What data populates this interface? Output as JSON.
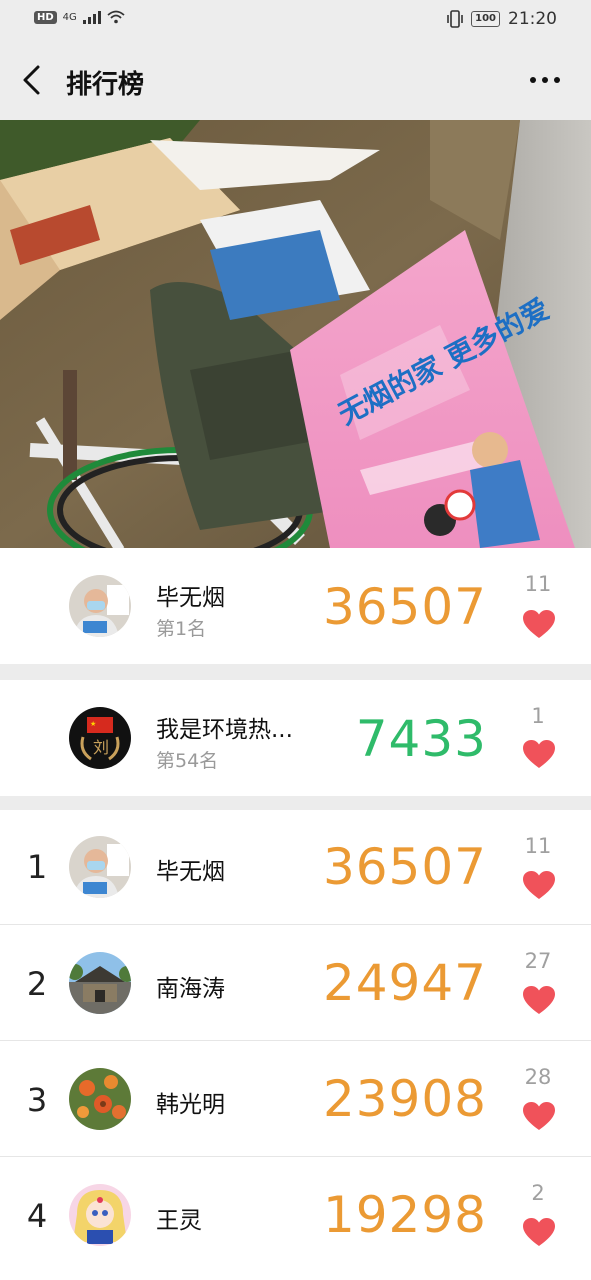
{
  "status_bar": {
    "hd": "HD",
    "network": "4G",
    "battery": "100",
    "time": "21:20"
  },
  "header": {
    "title": "排行榜"
  },
  "my_entries": [
    {
      "name": "毕无烟",
      "rank_label": "第1名",
      "steps": "36507",
      "likes": "11",
      "steps_color": "#eb9a34"
    },
    {
      "name": "我是环境热...",
      "rank_label": "第54名",
      "steps": "7433",
      "likes": "1",
      "steps_color": "#2fbb6a"
    }
  ],
  "ranking": [
    {
      "position": "1",
      "name": "毕无烟",
      "steps": "36507",
      "likes": "11"
    },
    {
      "position": "2",
      "name": "南海涛",
      "steps": "24947",
      "likes": "27"
    },
    {
      "position": "3",
      "name": "韩光明",
      "steps": "23908",
      "likes": "28"
    },
    {
      "position": "4",
      "name": "王灵",
      "steps": "19298",
      "likes": "2"
    }
  ],
  "hero_image": {
    "poster_text": "无烟的家 更多的爱"
  },
  "colors": {
    "accent_orange": "#eb9a34",
    "accent_green": "#2fbb6a",
    "heart_red": "#f0525a",
    "header_bg": "#ededed"
  }
}
